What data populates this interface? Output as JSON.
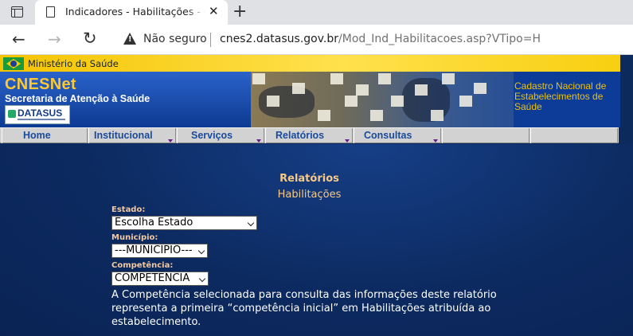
{
  "browser": {
    "tab_title": "Indicadores - Habilitações - Cnes",
    "security_label": "Não seguro",
    "url_host": "cnes2.datasus.gov.br",
    "url_path": "/Mod_Ind_Habilitacoes.asp?VTipo=H"
  },
  "site": {
    "ministry": "Ministério da Saúde",
    "brand": "CNESNet",
    "department": "Secretaria de Atenção à Saúde",
    "datasus": "DATASUS",
    "cadastro": "Cadastro Nacional de Estabelecimentos de Saúde"
  },
  "menu": [
    {
      "label": "Home",
      "has_submenu": false
    },
    {
      "label": "Institucional",
      "has_submenu": true
    },
    {
      "label": "Serviços",
      "has_submenu": true
    },
    {
      "label": "Relatórios",
      "has_submenu": true
    },
    {
      "label": "Consultas",
      "has_submenu": true
    }
  ],
  "page": {
    "title": "Relatórios",
    "subtitle": "Habilitações",
    "estado_label": "Estado:",
    "estado_value": "Escolha Estado",
    "municipio_label": "Município:",
    "municipio_value": "---MUNICÍPIO---",
    "competencia_label": "Competência:",
    "competencia_value": "COMPETENCIA",
    "note": "A Competência selecionada para consulta das informações deste relatório representa a primeira “competência inicial” em Habilitações atribuída ao estabelecimento."
  },
  "colors": {
    "page_background": "#0d2a5c",
    "brand_yellow": "#ffc830",
    "menu_text": "#1a4a9e",
    "heading_text": "#f7c987"
  },
  "icons": [
    "tab-switcher-icon",
    "page-icon",
    "close-icon",
    "new-tab-icon",
    "back-arrow-icon",
    "forward-arrow-icon",
    "reload-icon",
    "warning-icon",
    "brazil-flag-icon"
  ]
}
